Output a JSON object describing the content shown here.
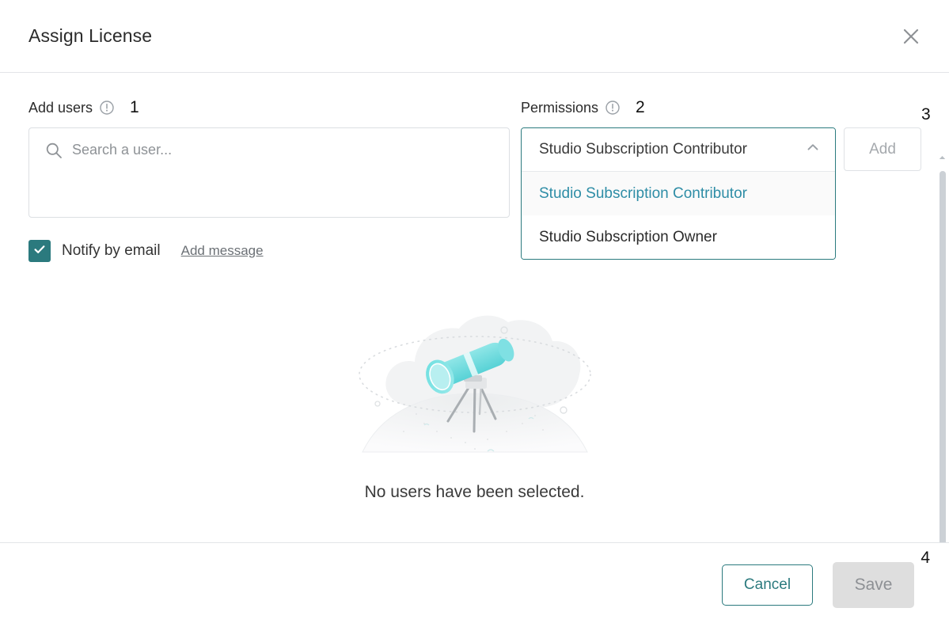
{
  "dialog": {
    "title": "Assign License",
    "close_icon": "close-icon"
  },
  "add_users": {
    "label": "Add users",
    "info_icon": "info-circle-icon",
    "annotation": "1",
    "search": {
      "placeholder": "Search a user...",
      "value": "",
      "icon": "search-icon"
    },
    "notify": {
      "label": "Notify by email",
      "checked": true,
      "check_icon": "checkmark-icon",
      "add_message_link": "Add message"
    }
  },
  "permissions": {
    "label": "Permissions",
    "info_icon": "info-circle-icon",
    "annotation": "2",
    "selected": "Studio Subscription Contributor",
    "chevron_icon": "chevron-up-icon",
    "expanded": true,
    "options": [
      {
        "label": "Studio Subscription Contributor",
        "selected": true
      },
      {
        "label": "Studio Subscription Owner",
        "selected": false
      }
    ]
  },
  "add_button": {
    "label": "Add",
    "annotation": "3",
    "disabled": true
  },
  "empty_state": {
    "illustration": "telescope-illustration",
    "message": "No users have been selected."
  },
  "footer": {
    "cancel_label": "Cancel",
    "save_label": "Save",
    "save_annotation": "4",
    "save_disabled": true
  },
  "scrollbar": {
    "up_icon": "scroll-up-arrow-icon",
    "down_icon": "scroll-down-arrow-icon"
  },
  "colors": {
    "teal": "#2b7a7e",
    "teal_light": "#2e8da6",
    "border": "#dcdfe3",
    "disabled_bg": "#dedede",
    "disabled_text": "#8d9094"
  }
}
